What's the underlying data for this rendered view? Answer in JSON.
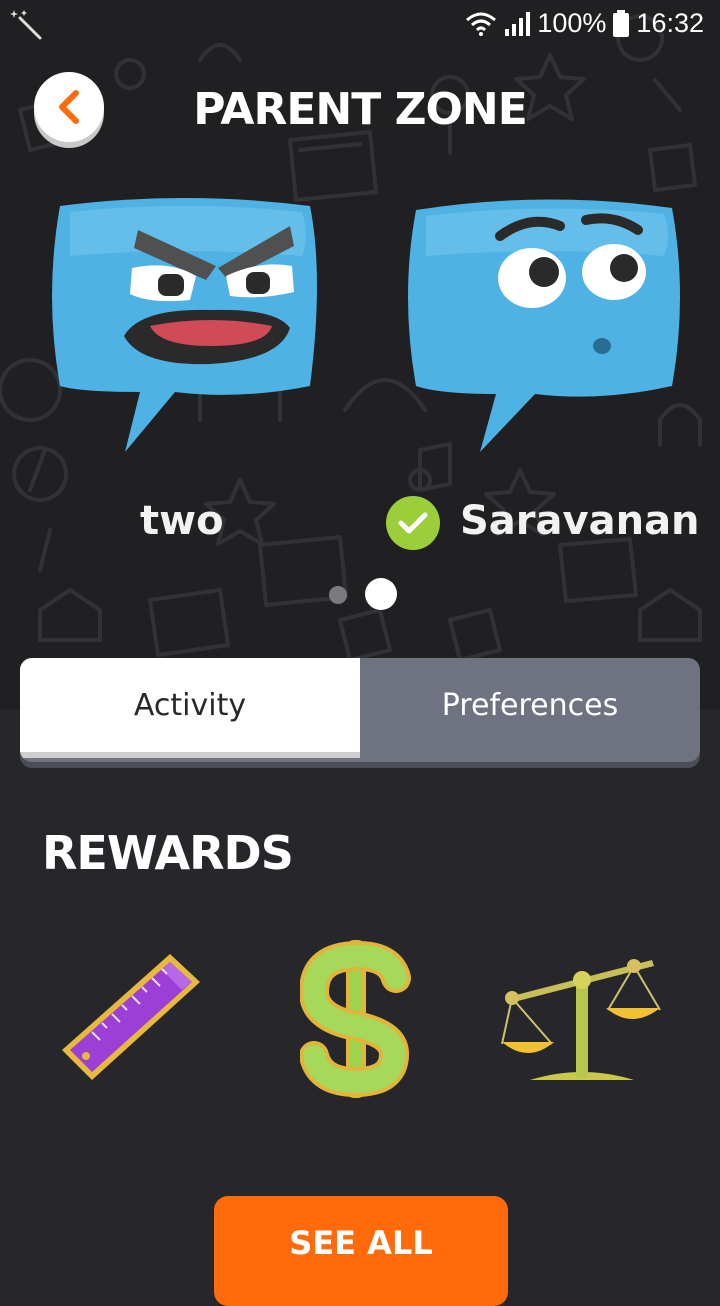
{
  "status_bar": {
    "battery": "100%",
    "time": "16:32",
    "icons": [
      "magic-wand-icon",
      "wifi-icon",
      "signal-icon",
      "battery-icon"
    ]
  },
  "header": {
    "title": "PARENT ZONE",
    "back_icon": "chevron-left-icon"
  },
  "profiles": [
    {
      "name": "two",
      "selected": false,
      "avatar": "angry-speech-bubble"
    },
    {
      "name": "Saravanan",
      "selected": true,
      "avatar": "surprised-speech-bubble"
    }
  ],
  "carousel": {
    "pages": 2,
    "current": 2
  },
  "tabs": [
    {
      "label": "Activity",
      "active": true
    },
    {
      "label": "Preferences",
      "active": false
    }
  ],
  "rewards": {
    "heading": "REWARDS",
    "items": [
      "ruler-icon",
      "dollar-icon",
      "scales-icon"
    ]
  },
  "see_all_label": "SEE ALL",
  "colors": {
    "accent": "#ff6b0a",
    "check": "#9bce3a",
    "avatar_blue": "#4fb2e4",
    "tab_inactive": "#6f7280"
  }
}
